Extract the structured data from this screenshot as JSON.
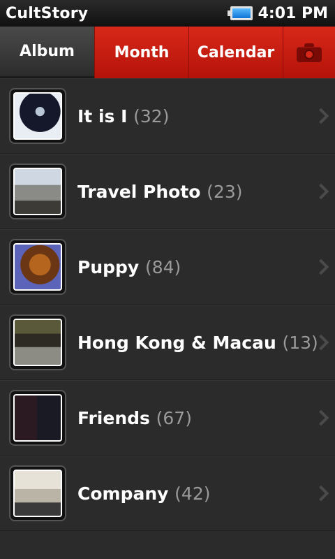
{
  "status": {
    "app_name": "CultStory",
    "time": "4:01 PM"
  },
  "tabs": {
    "album": "Album",
    "month": "Month",
    "calendar": "Calendar",
    "camera_icon": "camera-icon"
  },
  "albums": [
    {
      "title": "It is I",
      "count": "(32)"
    },
    {
      "title": "Travel Photo",
      "count": "(23)"
    },
    {
      "title": "Puppy",
      "count": "(84)"
    },
    {
      "title": "Hong Kong & Macau",
      "count": "(13)"
    },
    {
      "title": "Friends",
      "count": "(67)"
    },
    {
      "title": "Company",
      "count": "(42)"
    }
  ],
  "colors": {
    "accent_red": "#c81d10",
    "background": "#2b2b2b",
    "count_gray": "#9a9a9a"
  }
}
